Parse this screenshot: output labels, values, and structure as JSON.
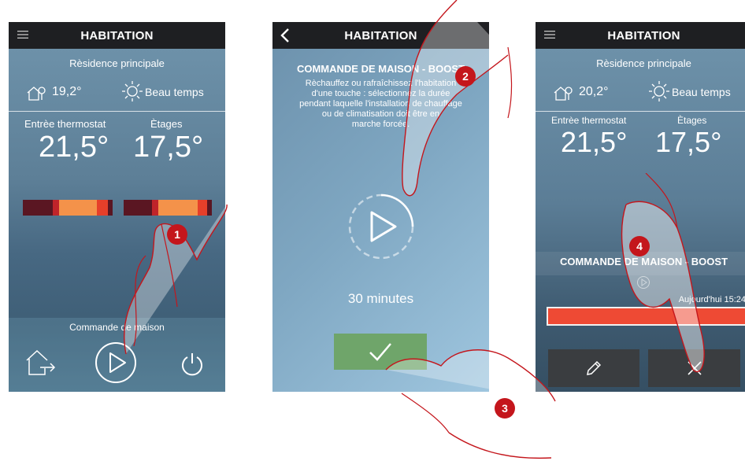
{
  "colors": {
    "accent_red": "#c4161c",
    "topbar": "#1e1f22",
    "gauge_dark": "#5a1622",
    "gauge_orange": "#f4924a",
    "gauge_red": "#e63f2a",
    "confirm_green": "#6fa56a"
  },
  "panel1": {
    "title": "HABITATION",
    "residence": "Rèsidence principale",
    "outdoor_temp": "19,2°",
    "weather": "Beau temps",
    "zone1_label": "Entrèe thermostat",
    "zone2_label": "Ètages",
    "zone1_temp": "21,5°",
    "zone2_temp": "17,5°",
    "footer_label": "Commande de maison",
    "icons": [
      "menu-icon",
      "house-pin-icon",
      "sun-icon",
      "exit-house-icon",
      "play-icon",
      "power-icon"
    ]
  },
  "panel2": {
    "title": "HABITATION",
    "heading": "COMMANDE DE MAISON - BOOST",
    "desc_lines": [
      "Rèchauffez ou rafraîchissez l'habitation",
      "d'une touche : sélectionnez la durée",
      "pendant laquelle l'installation de chauffage",
      "ou de climatisation doit être en",
      "marche forcée."
    ],
    "duration": "30 minutes",
    "icons": [
      "back-icon",
      "play-icon",
      "check-icon"
    ]
  },
  "panel3": {
    "title": "HABITATION",
    "residence": "Rèsidence principale",
    "outdoor_temp": "20,2°",
    "weather": "Beau temps",
    "zone1_label": "Entrèe thermostat",
    "zone2_label": "Ètages",
    "zone1_temp": "21,5°",
    "zone2_temp": "17,5°",
    "boost_heading": "COMMANDE DE MAISON - BOOST",
    "boost_time": "Aujourd'hui 15:24",
    "icons": [
      "menu-icon",
      "house-pin-icon",
      "sun-icon",
      "pencil-icon",
      "close-icon"
    ]
  },
  "steps": [
    "1",
    "2",
    "3",
    "4"
  ]
}
